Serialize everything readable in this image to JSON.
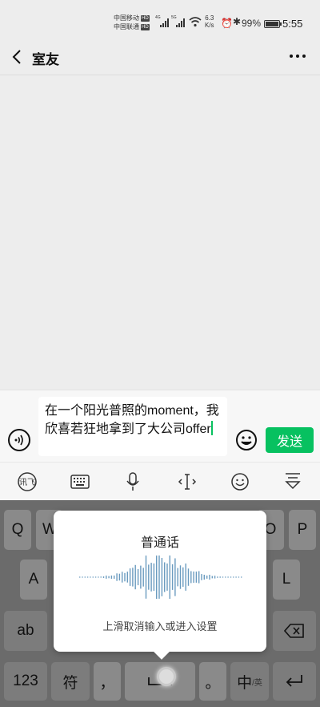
{
  "status_bar": {
    "carrier1": "中国移动",
    "carrier2": "中国联通",
    "hd": "HD",
    "sig1_label": "4G",
    "sig2_label": "5G",
    "net_speed": "6.3",
    "net_unit": "K/s",
    "battery_pct": "99%",
    "battery_level": 0.99,
    "time": "5:55"
  },
  "header": {
    "title": "室友"
  },
  "input": {
    "text": "在一个阳光普照的moment，我欣喜若狂地拿到了大公司offer"
  },
  "send_label": "发送",
  "voice_panel": {
    "title": "普通话",
    "hint": "上滑取消输入或进入设置"
  },
  "keyboard": {
    "row1": [
      "Q",
      "W",
      "",
      "",
      "",
      "",
      "",
      "",
      "O",
      "P"
    ],
    "row2_left": "A",
    "row2_right": "L",
    "ab": "ab",
    "num": "123",
    "sym": "符",
    "comma": "，",
    "period": "。",
    "lang_main": "中",
    "lang_sub": "/英"
  },
  "colors": {
    "accent": "#07c160",
    "wave": "#6a9bbf"
  }
}
